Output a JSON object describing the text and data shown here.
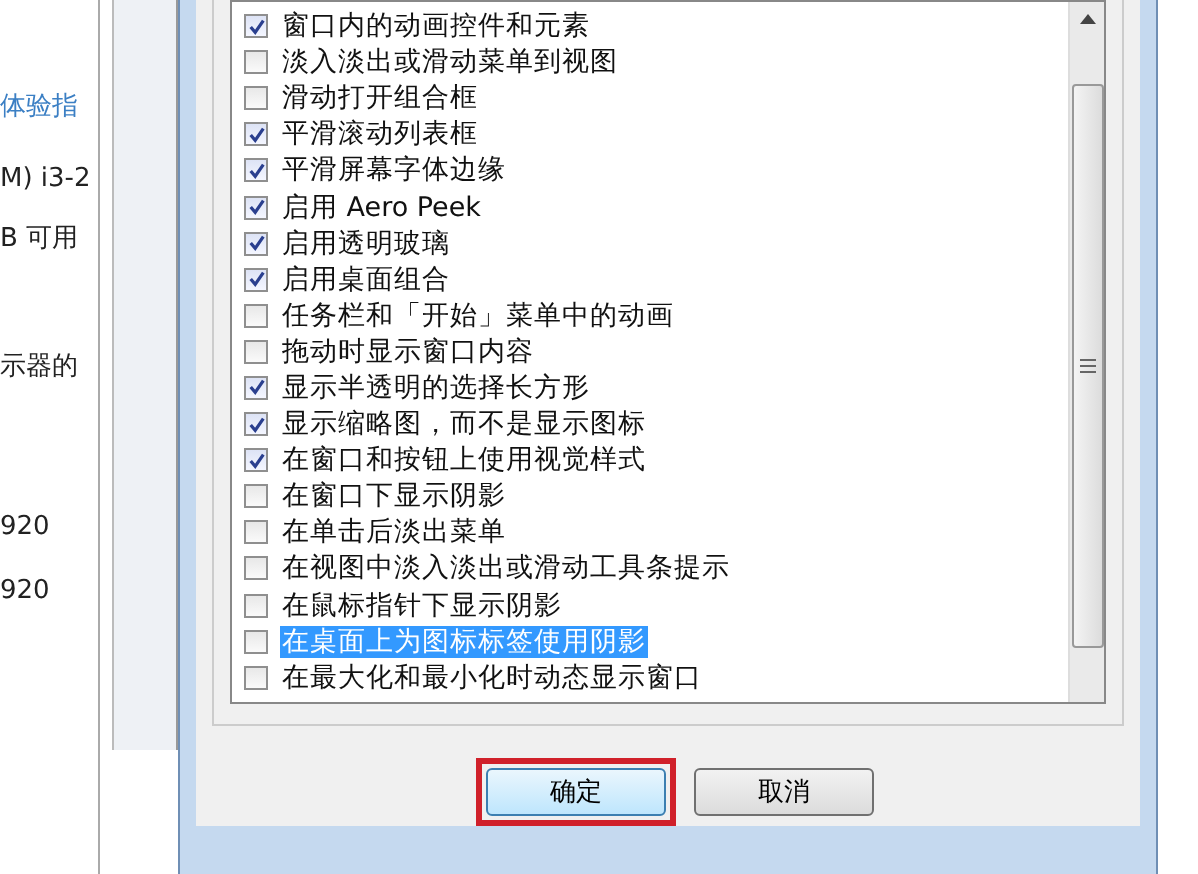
{
  "background_window": {
    "lines": [
      {
        "kind": "link",
        "text": "体验指"
      },
      {
        "kind": "text",
        "text": "M) i3-2"
      },
      {
        "kind": "text",
        "text": "B 可用"
      },
      {
        "kind": "text",
        "text": "示器的"
      },
      {
        "kind": "text",
        "text": "920"
      },
      {
        "kind": "text",
        "text": "920"
      }
    ]
  },
  "options": [
    {
      "label": "窗口内的动画控件和元素",
      "checked": true,
      "selected": false
    },
    {
      "label": "淡入淡出或滑动菜单到视图",
      "checked": false,
      "selected": false
    },
    {
      "label": "滑动打开组合框",
      "checked": false,
      "selected": false
    },
    {
      "label": "平滑滚动列表框",
      "checked": true,
      "selected": false
    },
    {
      "label": "平滑屏幕字体边缘",
      "checked": true,
      "selected": false
    },
    {
      "label": "启用 Aero Peek",
      "checked": true,
      "selected": false
    },
    {
      "label": "启用透明玻璃",
      "checked": true,
      "selected": false
    },
    {
      "label": "启用桌面组合",
      "checked": true,
      "selected": false
    },
    {
      "label": "任务栏和「开始」菜单中的动画",
      "checked": false,
      "selected": false
    },
    {
      "label": "拖动时显示窗口内容",
      "checked": false,
      "selected": false
    },
    {
      "label": "显示半透明的选择长方形",
      "checked": true,
      "selected": false
    },
    {
      "label": "显示缩略图，而不是显示图标",
      "checked": true,
      "selected": false
    },
    {
      "label": "在窗口和按钮上使用视觉样式",
      "checked": true,
      "selected": false
    },
    {
      "label": "在窗口下显示阴影",
      "checked": false,
      "selected": false
    },
    {
      "label": "在单击后淡出菜单",
      "checked": false,
      "selected": false
    },
    {
      "label": "在视图中淡入淡出或滑动工具条提示",
      "checked": false,
      "selected": false
    },
    {
      "label": "在鼠标指针下显示阴影",
      "checked": false,
      "selected": false
    },
    {
      "label": "在桌面上为图标标签使用阴影",
      "checked": false,
      "selected": true
    },
    {
      "label": "在最大化和最小化时动态显示窗口",
      "checked": false,
      "selected": false
    }
  ],
  "buttons": [
    {
      "label": "确定",
      "highlighted": true
    },
    {
      "label": "取消",
      "highlighted": false
    }
  ]
}
